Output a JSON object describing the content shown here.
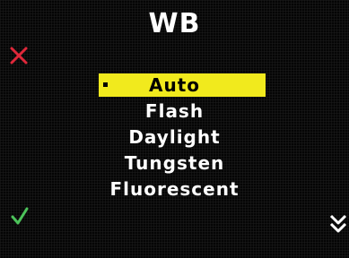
{
  "title": "WB",
  "icons": {
    "cancel": "x-icon",
    "confirm": "checkmark-icon",
    "more": "double-chevron-down-icon"
  },
  "colors": {
    "highlight": "#f1ea1d",
    "cancel": "#e0283a",
    "confirm": "#4cc25a"
  },
  "menu": {
    "items": [
      {
        "label": "Auto",
        "selected": true
      },
      {
        "label": "Flash",
        "selected": false
      },
      {
        "label": "Daylight",
        "selected": false
      },
      {
        "label": "Tungsten",
        "selected": false
      },
      {
        "label": "Fluorescent",
        "selected": false
      }
    ]
  }
}
